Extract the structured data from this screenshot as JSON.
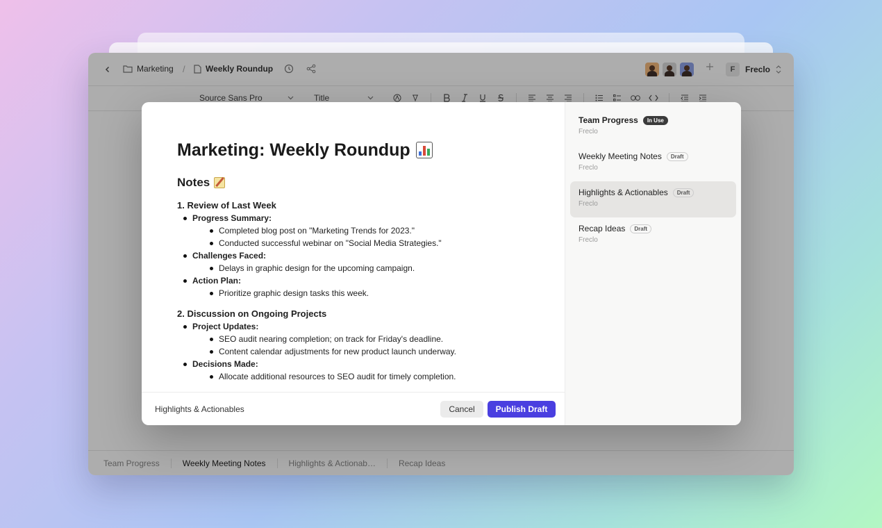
{
  "topbar": {
    "breadcrumb_folder": "Marketing",
    "breadcrumb_sep": "/",
    "breadcrumb_doc": "Weekly Roundup",
    "user_initial": "F",
    "user_name": "Freclo"
  },
  "toolbar": {
    "font": "Source Sans Pro",
    "text_style": "Title"
  },
  "bottom_tabs": [
    "Team Progress",
    "Weekly Meeting Notes",
    "Highlights & Actionab…",
    "Recap Ideas"
  ],
  "document": {
    "title": "Marketing: Weekly Roundup",
    "notes_heading": "Notes",
    "section1": {
      "heading": "1. Review of Last Week",
      "progress_label": "Progress Summary:",
      "progress_items": [
        "Completed blog post on \"Marketing Trends for 2023.\"",
        "Conducted successful webinar on \"Social Media Strategies.\""
      ],
      "challenges_label": "Challenges Faced:",
      "challenges_items": [
        "Delays in graphic design for the upcoming campaign."
      ],
      "action_label": "Action Plan:",
      "action_items": [
        "Prioritize graphic design tasks this week."
      ]
    },
    "section2": {
      "heading": "2. Discussion on Ongoing Projects",
      "updates_label": "Project Updates:",
      "updates_items": [
        "SEO audit nearing completion; on track for Friday's deadline.",
        "Content calendar adjustments for new product launch underway."
      ],
      "decisions_label": "Decisions Made:",
      "decisions_items": [
        "Allocate additional resources to SEO audit for timely completion."
      ]
    }
  },
  "modal_footer": {
    "label": "Highlights & Actionables",
    "cancel": "Cancel",
    "publish": "Publish Draft"
  },
  "templates": [
    {
      "name": "Team Progress",
      "badge": "In Use",
      "owner": "Freclo"
    },
    {
      "name": "Weekly Meeting Notes",
      "badge": "Draft",
      "owner": "Freclo"
    },
    {
      "name": "Highlights & Actionables",
      "badge": "Draft",
      "owner": "Freclo"
    },
    {
      "name": "Recap Ideas",
      "badge": "Draft",
      "owner": "Freclo"
    }
  ],
  "colors": {
    "accent": "#4a3fe0",
    "badge_inuse": "#3b3b3b"
  }
}
